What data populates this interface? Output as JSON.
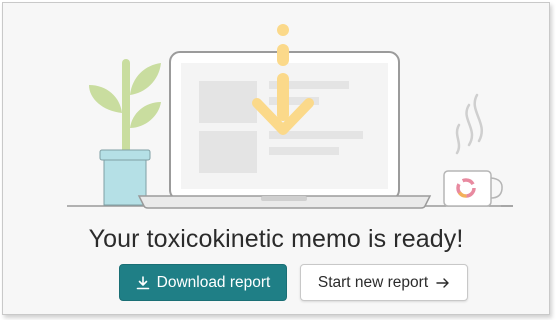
{
  "heading": "Your toxicokinetic memo is ready!",
  "actions": {
    "download_label": "Download report",
    "new_report_label": "Start new report"
  },
  "icons": {
    "download": "download-icon",
    "arrow": "arrow-right-icon"
  },
  "colors": {
    "primary": "#1f7f86",
    "arrow_accent": "#fbd98a",
    "plant_leaf": "#c9dd9f",
    "pot": "#b5e0e6"
  }
}
